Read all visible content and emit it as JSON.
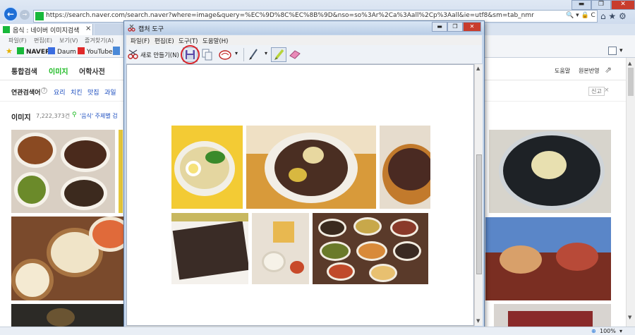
{
  "browser": {
    "back_icon": "←",
    "forward_icon": "→",
    "url": "https://search.naver.com/search.naver?where=image&query=%EC%9D%8C%EC%8B%9D&nso=so%3Ar%2Ca%3Aall%2Cp%3Aall&ie=utf8&sm=tab_nmr",
    "address_icons": "🔍 ▾ 🔒 C",
    "window_controls": {
      "minimize": "▬",
      "restore": "❐",
      "close": "✕"
    },
    "right_icons": "⌂ ★ ⚙",
    "tab": {
      "title": "음식 : 네이버 이미지검색",
      "close": "×"
    },
    "menu": [
      "파일(F)",
      "편집(E)",
      "보기(V)",
      "즐겨찾기(A)"
    ],
    "favorites": [
      {
        "label": "NAVER",
        "color": "#18b83a"
      },
      {
        "label": "Daum",
        "color": "#3a6de0"
      },
      {
        "label": "YouTube",
        "color": "#e02a2a"
      }
    ],
    "page_tools": "▾",
    "zoom": "100%"
  },
  "naver": {
    "nav_tabs": [
      "통합검색",
      "이미지",
      "어학사전"
    ],
    "active_tab_color": "#19b91f",
    "nav_right": [
      "도움말",
      "원본반영"
    ],
    "related_label": "연관검색어",
    "related_help": "?",
    "related_terms": [
      "요리",
      "치킨",
      "맛집",
      "과일"
    ],
    "report": "신고",
    "report_close": "×",
    "images_label": "이미지",
    "images_count": "7,222,373건",
    "theme_search": "'음식' 주제별 검"
  },
  "snip": {
    "title": "캡처 도구",
    "window_controls": {
      "minimize": "▬",
      "restore": "❐",
      "close": "✕"
    },
    "menu": [
      "파일(F)",
      "편집(E)",
      "도구(T)",
      "도움말(H)"
    ],
    "new_button": "새로 만들기(N)",
    "tools": {
      "new_icon": "scissors-icon",
      "save_icon": "floppy-save-icon",
      "copy_icon": "copy-icon",
      "send_icon": "send-email-icon",
      "pen_icon": "pen-icon",
      "highlighter_icon": "highlighter-icon",
      "eraser_icon": "eraser-icon",
      "dropdown": "▾"
    },
    "save_highlight_color": "#d9232a"
  }
}
